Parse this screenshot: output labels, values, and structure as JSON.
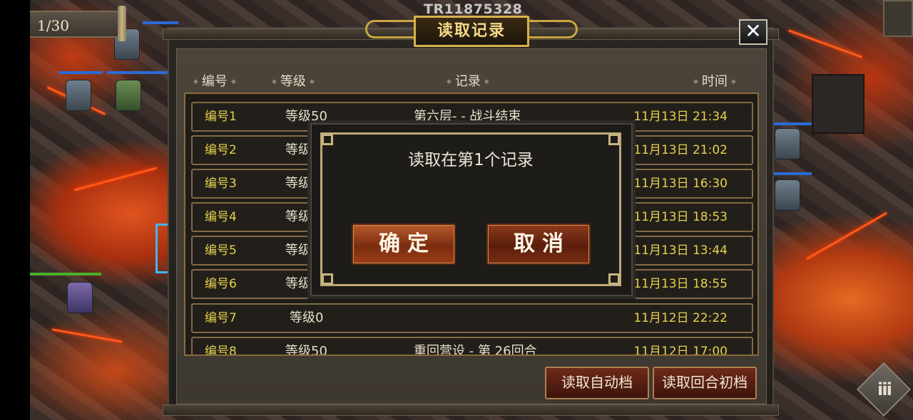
{
  "game": {
    "turn_counter": "1/30",
    "watermark": "TR11875328",
    "menu_icon": "ⅲ"
  },
  "dialog_window": {
    "title": "读取记录",
    "close_label": "✕",
    "columns": {
      "id": "编号",
      "level": "等级",
      "record": "记录",
      "time": "时间"
    },
    "rows": [
      {
        "id": "编号1",
        "level": "等级50",
        "record": "第六层- - 战斗结束",
        "time": "11月13日 21:34"
      },
      {
        "id": "编号2",
        "level": "等级",
        "record": "",
        "time": "11月13日 21:02"
      },
      {
        "id": "编号3",
        "level": "等级",
        "record": "",
        "time": "11月13日 16:30"
      },
      {
        "id": "编号4",
        "level": "等级",
        "record": "",
        "time": "11月13日 18:53"
      },
      {
        "id": "编号5",
        "level": "等级",
        "record": "",
        "time": "11月13日 13:44"
      },
      {
        "id": "编号6",
        "level": "等级",
        "record": "",
        "time": "11月13日 18:55"
      },
      {
        "id": "编号7",
        "level": "等级0",
        "record": "",
        "time": "11月12日 22:22"
      },
      {
        "id": "编号8",
        "level": "等级50",
        "record": "重回营设 - 第 26回合",
        "time": "11月12日 17:00"
      }
    ],
    "buttons": {
      "load_auto": "读取自动档",
      "load_turn_start": "读取回合初档"
    }
  },
  "confirm": {
    "message": "读取在第1个记录",
    "ok_label": "确定",
    "cancel_label": "取消"
  },
  "colors": {
    "accent_gold": "#d6b24c",
    "slot_text_yellow": "#e6d24a",
    "button_red": "#7a2c10"
  }
}
